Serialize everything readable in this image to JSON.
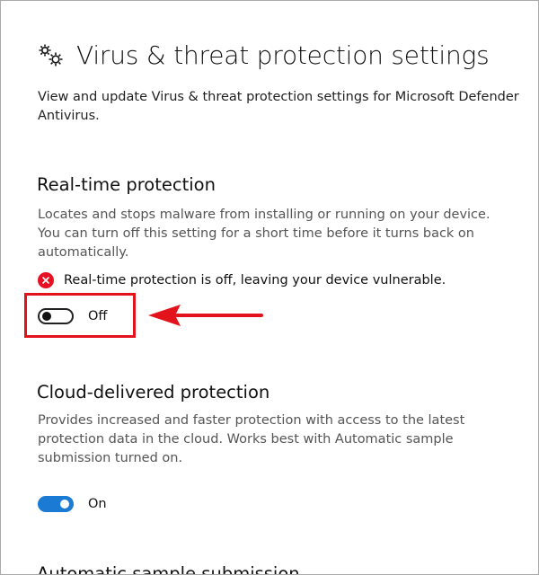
{
  "header": {
    "title": "Virus & threat protection settings",
    "description": "View and update Virus & threat protection settings for Microsoft Defender Antivirus."
  },
  "realtime": {
    "title": "Real-time protection",
    "description": "Locates and stops malware from installing or running on your device. You can turn off this setting for a short time before it turns back on automatically.",
    "alert_text": "Real-time protection is off, leaving your device vulnerable.",
    "toggle_label": "Off",
    "toggle_state": "off"
  },
  "cloud": {
    "title": "Cloud-delivered protection",
    "description": "Provides increased and faster protection with access to the latest protection data in the cloud. Works best with Automatic sample submission turned on.",
    "toggle_label": "On",
    "toggle_state": "on"
  },
  "next_section_partial_title": "Automatic sample submission",
  "colors": {
    "accent": "#1b7bd4",
    "error": "#e81123",
    "annotation": "#e3131c"
  },
  "icons": [
    "gear-icon",
    "error-icon"
  ]
}
